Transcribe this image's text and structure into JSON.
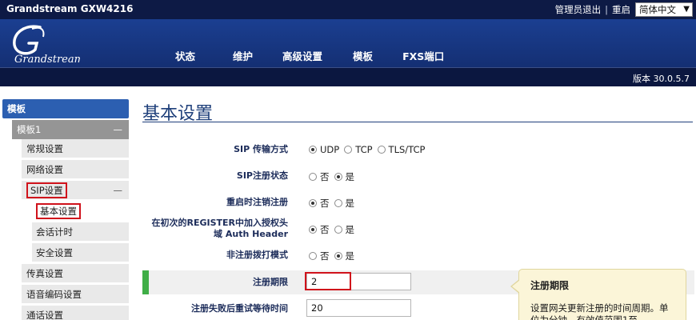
{
  "topbar": {
    "model": "Grandstream GXW4216",
    "admin_logout": "管理员退出",
    "separator": "|",
    "reboot": "重启",
    "language": "简体中文"
  },
  "logo": {
    "text": "Grandstream"
  },
  "nav": {
    "items": [
      "状态",
      "维护",
      "高级设置",
      "模板",
      "FXS端口"
    ]
  },
  "version": "版本 30.0.5.7",
  "sidebar": {
    "main": "模板",
    "template1": "模板1",
    "minus": "—",
    "items": {
      "general": "常规设置",
      "network": "网络设置",
      "sip": "SIP设置",
      "basic": "基本设置",
      "session_timer": "会话计时",
      "security": "安全设置",
      "fax": "传真设置",
      "codec": "语音编码设置",
      "call": "通话设置"
    }
  },
  "page": {
    "title": "基本设置"
  },
  "form": {
    "sip_transport": {
      "label": "SIP 传输方式",
      "options": [
        "UDP",
        "TCP",
        "TLS/TCP"
      ],
      "selected": "UDP"
    },
    "sip_registration": {
      "label": "SIP注册状态",
      "options": [
        "否",
        "是"
      ],
      "selected": "是"
    },
    "unregister_on_reboot": {
      "label": "重启时注销注册",
      "options": [
        "否",
        "是"
      ],
      "selected": "否"
    },
    "auth_header": {
      "label_line1": "在初次的REGISTER中加入授权头",
      "label_line2": "域 Auth Header",
      "options": [
        "否",
        "是"
      ],
      "selected": "否"
    },
    "unregistered_dial": {
      "label": "非注册拨打模式",
      "options": [
        "否",
        "是"
      ],
      "selected": "是"
    },
    "register_expiration": {
      "label": "注册期限",
      "value": "2"
    },
    "reregister_wait": {
      "label": "注册失败后重试等待时间",
      "value": "20"
    }
  },
  "tooltip": {
    "title": "注册期限",
    "body": "设置网关更新注册的时间周期。单位为分钟，有效值范围1至"
  },
  "colors": {
    "topbar": "#0d1a45",
    "header": "#1b3f91",
    "sidebar_active": "#2c5fb1",
    "highlight": "#d0121b",
    "green_marker": "#3fae47"
  }
}
